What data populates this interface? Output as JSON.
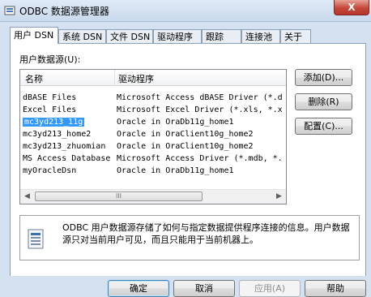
{
  "window": {
    "title": "ODBC 数据源管理器",
    "close_label": "X"
  },
  "tabs": [
    {
      "label": "用户 DSN",
      "active": true
    },
    {
      "label": "系统 DSN"
    },
    {
      "label": "文件 DSN"
    },
    {
      "label": "驱动程序"
    },
    {
      "label": "跟踪"
    },
    {
      "label": "连接池"
    },
    {
      "label": "关于"
    }
  ],
  "user_dsn": {
    "group_label": "用户数据源(U):",
    "columns": {
      "name": "名称",
      "driver": "驱动程序"
    },
    "rows": [
      {
        "name": "dBASE Files",
        "driver": "Microsoft Access dBASE Driver (*.d"
      },
      {
        "name": "Excel Files",
        "driver": "Microsoft Excel Driver (*.xls, *.x"
      },
      {
        "name": "mc3yd213_11g",
        "driver": "Oracle in OraDb11g_home1",
        "selected": true
      },
      {
        "name": "mc3yd213_home2",
        "driver": "Oracle in OraClient10g_home2"
      },
      {
        "name": "mc3yd213_zhuomian",
        "driver": "Oracle in OraClient10g_home2"
      },
      {
        "name": "MS Access Database",
        "driver": "Microsoft Access Driver (*.mdb, *."
      },
      {
        "name": "myOracleDsn",
        "driver": "Oracle in OraDb11g_home1"
      }
    ],
    "scroll_left": "◀",
    "scroll_right": "▶",
    "scroll_grip": "III",
    "buttons": {
      "add": "添加(D)...",
      "remove": "删除(R)",
      "configure": "配置(C)..."
    },
    "info_text": "ODBC 用户数据源存储了如何与指定数据提供程序连接的信息。用户数据源只对当前用户可见，而且只能用于当前机器上。"
  },
  "footer": {
    "ok": "确定",
    "cancel": "取消",
    "apply": "应用(A)",
    "help": "帮助"
  }
}
